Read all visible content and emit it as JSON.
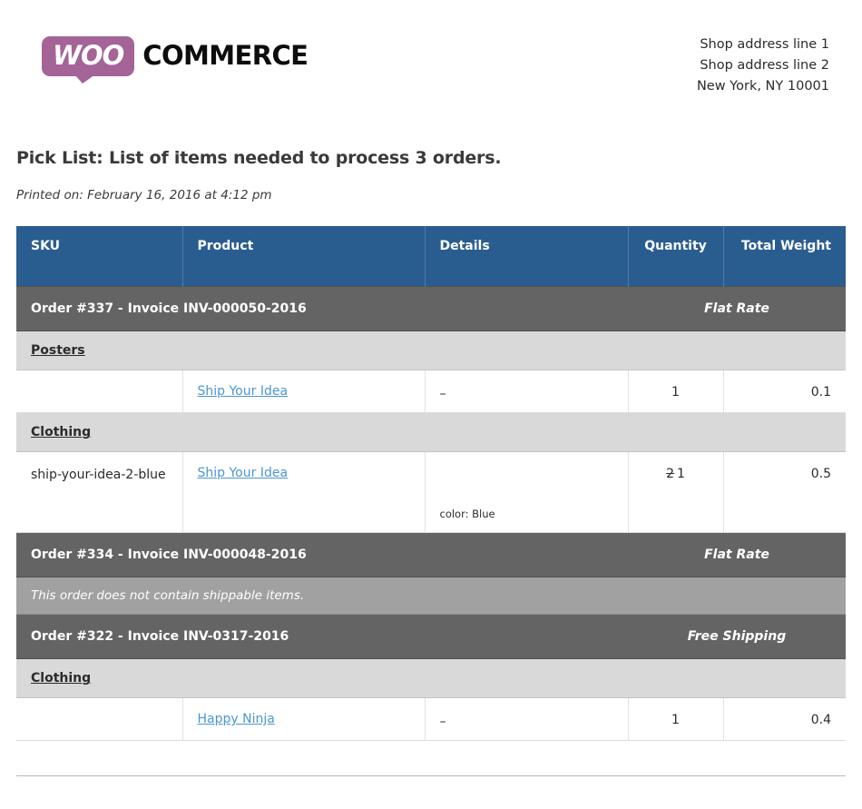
{
  "brand": {
    "logo_badge_text": "WOO",
    "logo_word": "COMMERCE",
    "logo_color": "#a46497"
  },
  "shop_address": {
    "line1": "Shop address line 1",
    "line2": "Shop address line 2",
    "line3": "New York, NY 10001"
  },
  "document": {
    "title": "Pick List: List of items needed to process 3 orders.",
    "printed_on": "Printed on: February 16, 2016 at 4:12 pm"
  },
  "table": {
    "headers": {
      "sku": "SKU",
      "product": "Product",
      "details": "Details",
      "quantity": "Quantity",
      "total_weight": "Total Weight"
    },
    "orders": [
      {
        "heading": "Order #337 - Invoice INV-000050-2016",
        "shipping_method": "Flat Rate",
        "note": null,
        "groups": [
          {
            "category": "Posters",
            "items": [
              {
                "sku": "",
                "product": "Ship Your Idea",
                "details": "–",
                "details_meta": "",
                "qty_original": "",
                "qty": "1",
                "weight": "0.1"
              }
            ]
          },
          {
            "category": "Clothing",
            "items": [
              {
                "sku": "ship-your-idea-2-blue",
                "product": "Ship Your Idea",
                "details": "",
                "details_meta": "color: Blue",
                "qty_original": "2",
                "qty": "1",
                "weight": "0.5"
              }
            ]
          }
        ]
      },
      {
        "heading": "Order #334 - Invoice INV-000048-2016",
        "shipping_method": "Flat Rate",
        "note": "This order does not contain shippable items.",
        "groups": []
      },
      {
        "heading": "Order #322 - Invoice INV-0317-2016",
        "shipping_method": "Free Shipping",
        "note": null,
        "groups": [
          {
            "category": "Clothing",
            "items": [
              {
                "sku": "",
                "product": "Happy Ninja",
                "details": "–",
                "details_meta": "",
                "qty_original": "",
                "qty": "1",
                "weight": "0.4"
              }
            ]
          }
        ]
      }
    ]
  },
  "colors": {
    "header_blue": "#2a5d8f",
    "order_gray": "#646464",
    "note_gray": "#a1a1a1",
    "category_gray": "#d9d9d9",
    "link_blue": "#4a96d2"
  }
}
